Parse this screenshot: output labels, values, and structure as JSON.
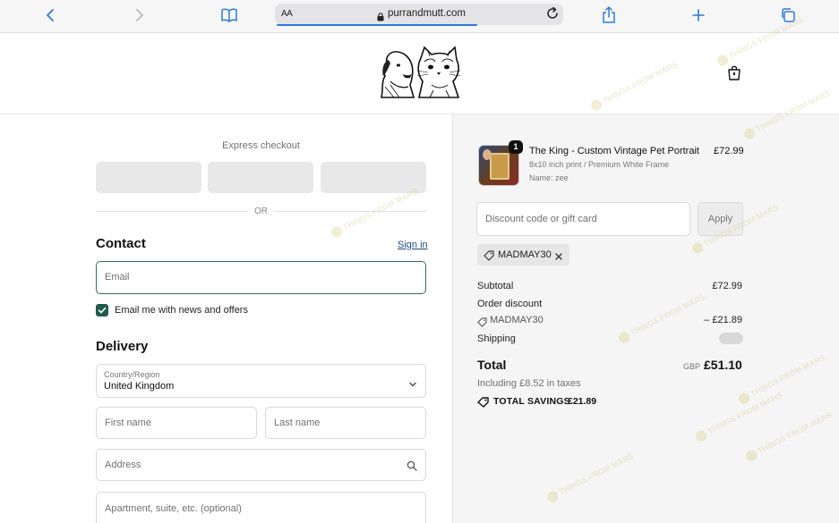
{
  "browser": {
    "text_size_label": "AA",
    "url": "purrandmutt.com"
  },
  "checkout": {
    "express_label": "Express checkout",
    "or_label": "OR",
    "contact": {
      "title": "Contact",
      "sign_in": "Sign in",
      "email_placeholder": "Email",
      "newsletter_label": "Email me with news and offers",
      "newsletter_checked": true
    },
    "delivery": {
      "title": "Delivery",
      "country_label": "Country/Region",
      "country_value": "United Kingdom",
      "first_name_placeholder": "First name",
      "last_name_placeholder": "Last name",
      "address_placeholder": "Address",
      "apartment_placeholder": "Apartment, suite, etc. (optional)"
    }
  },
  "summary": {
    "item": {
      "quantity": "1",
      "name": "The King - Custom Vintage Pet Portrait",
      "variant": "8x10 inch print / Premium White Frame",
      "custom": "Name: zee",
      "price": "£72.99"
    },
    "discount_placeholder": "Discount code or gift card",
    "apply_label": "Apply",
    "applied_code": "MADMAY30",
    "subtotal_label": "Subtotal",
    "subtotal_value": "£72.99",
    "order_discount_label": "Order discount",
    "discount_code": "MADMAY30",
    "discount_value": "– £21.89",
    "shipping_label": "Shipping",
    "total_label": "Total",
    "total_currency": "GBP",
    "total_value": "£51.10",
    "tax_note": "Including £8.52 in taxes",
    "savings_label": "TOTAL SAVINGS",
    "savings_value": "£21.89"
  },
  "watermark_text": "THINGS FROM MARS",
  "colors": {
    "accent": "#2e6f5e",
    "checkbox": "#1f5a4d",
    "link": "#1a4a7a",
    "browser_blue": "#2f7ad6"
  }
}
